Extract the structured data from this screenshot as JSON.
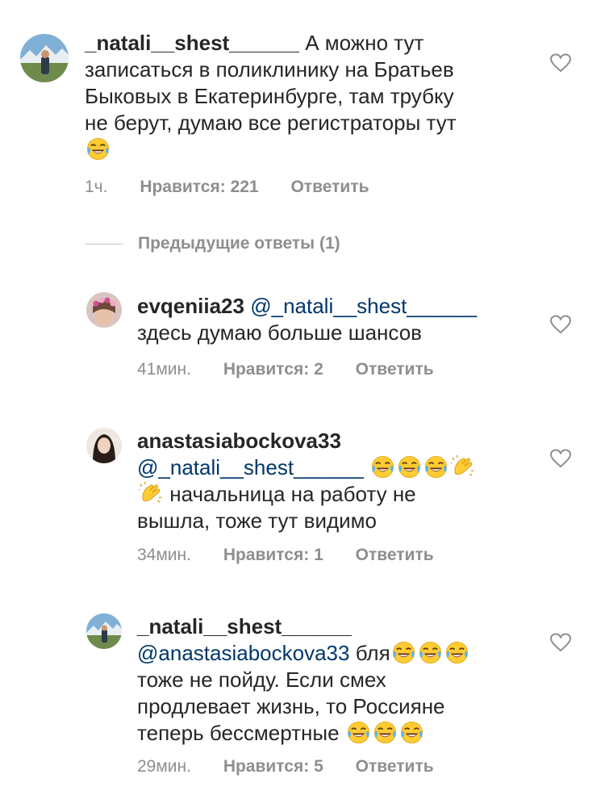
{
  "comments": [
    {
      "username": "_natali__shest______",
      "text_lines": [
        "А можно тут",
        "записаться в поликлинику на Братьев",
        "Быковых в Екатеринбурге,  там трубку",
        "не берут, думаю  все регистраторы тут"
      ],
      "time": "1ч.",
      "likes": "Нравится: 221",
      "reply": "Ответить",
      "avatar_icon": "mountain-landscape-avatar"
    },
    {
      "username": "evqeniia23",
      "mention": "@_natali__shest______",
      "text": "здесь думаю больше шансов",
      "time": "41мин.",
      "likes": "Нравится: 2",
      "reply": "Ответить",
      "avatar_icon": "woman-flower-crown-avatar"
    },
    {
      "username": "anastasiabockova33",
      "mention": "@_natali__shest______",
      "text_a": "начальница на работу не",
      "text_b": "вышла, тоже тут видимо",
      "time": "34мин.",
      "likes": "Нравится: 1",
      "reply": "Ответить",
      "avatar_icon": "woman-dark-hair-avatar"
    },
    {
      "username": "_natali__shest______",
      "mention": "@anastasiabockova33",
      "text_a": "бля",
      "text_b": "тоже  не пойду. Если смех",
      "text_c": "продлевает жизнь, то Россияне",
      "text_d": "теперь бессмертные",
      "time": "29мин.",
      "likes": "Нравится: 5",
      "reply": "Ответить",
      "avatar_icon": "mountain-landscape-avatar"
    }
  ],
  "previous_replies": "Предыдущие ответы (1)",
  "colors": {
    "text": "#262626",
    "meta": "#8e8e8e",
    "mention": "#00376b"
  },
  "icons": [
    "heart-icon",
    "tears-of-joy-emoji",
    "clapping-hands-emoji"
  ]
}
